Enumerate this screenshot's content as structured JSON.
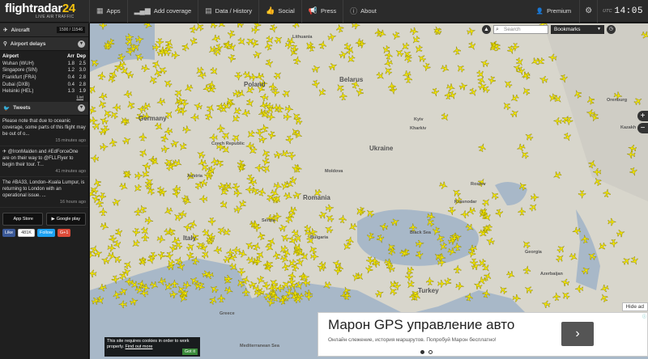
{
  "app": {
    "logo_text": "flightradar",
    "logo_num": "24",
    "logo_sub": "LIVE AIR TRAFFIC"
  },
  "nav": [
    {
      "label": "Apps",
      "icon": "grid-icon"
    },
    {
      "label": "Add coverage",
      "icon": "signal-icon"
    },
    {
      "label": "Data / History",
      "icon": "database-icon"
    },
    {
      "label": "Social",
      "icon": "thumbs-up-icon"
    },
    {
      "label": "Press",
      "icon": "megaphone-icon"
    },
    {
      "label": "About",
      "icon": "info-icon"
    }
  ],
  "topbar": {
    "premium_label": "Premium",
    "utc_label": "UTC",
    "time": "14:05"
  },
  "aircraft": {
    "label": "Aircraft",
    "count": "1500 / 11546"
  },
  "delays": {
    "label": "Airport delays",
    "headers": [
      "Airport",
      "Arr",
      "Dep"
    ],
    "rows": [
      [
        "Wuhan (WUH)",
        "1.8",
        "2.5"
      ],
      [
        "Singapore (SIN)",
        "1.2",
        "3.0"
      ],
      [
        "Frankfurt (FRA)",
        "0.4",
        "2.8"
      ],
      [
        "Dubai (DXB)",
        "0.4",
        "2.8"
      ],
      [
        "Helsinki (HEL)",
        "1.3",
        "1.9"
      ]
    ],
    "list_link": "List"
  },
  "tweets": {
    "label": "Tweets",
    "items": [
      {
        "text": "Please note that due to oceanic coverage, some parts of this flight may be out of o...",
        "time": "15 minutes ago"
      },
      {
        "text": "✈ @IronMaiden and #EdForceOne are on their way to @FLLFlyer to begin their tour. T...",
        "time": "41 minutes ago"
      },
      {
        "text": "The #BA33, London–Kuala Lumpur, is returning to London with an operational issue. ...",
        "time": "16 hours ago"
      }
    ]
  },
  "stores": {
    "appstore": "App Store",
    "googleplay": "Google play",
    "appstore_pre": "Download on the",
    "googleplay_pre": "GET IT ON"
  },
  "social": {
    "like": "Like",
    "like_count": "481K",
    "follow": "Follow",
    "gplus": "G+1"
  },
  "map": {
    "search_placeholder": "Search",
    "bookmarks_label": "Bookmarks",
    "labels": [
      "Lithuania",
      "Belarus",
      "Poland",
      "Ukraine",
      "Germany",
      "Czech Republic",
      "Austria",
      "Moldova",
      "Romania",
      "Kharkiv",
      "Kyiv",
      "Orenburg",
      "Kazakh",
      "Black Sea",
      "Bulgaria",
      "Italy",
      "Georgia",
      "Azerbaijan",
      "Turkey",
      "Greece",
      "Mediterranean Sea",
      "Krasnodar",
      "Rostov",
      "Serbia"
    ]
  },
  "cookie": {
    "text": "This site requires cookies in order to work properly.",
    "link": "Find out more",
    "button": "Got it"
  },
  "ad": {
    "hide_label": "Hide ad",
    "title": "Марон GPS управление авто",
    "subtitle": "Онлайн слежение, история маршрутов. Попробуй Марон бесплатно!",
    "go": "›"
  }
}
